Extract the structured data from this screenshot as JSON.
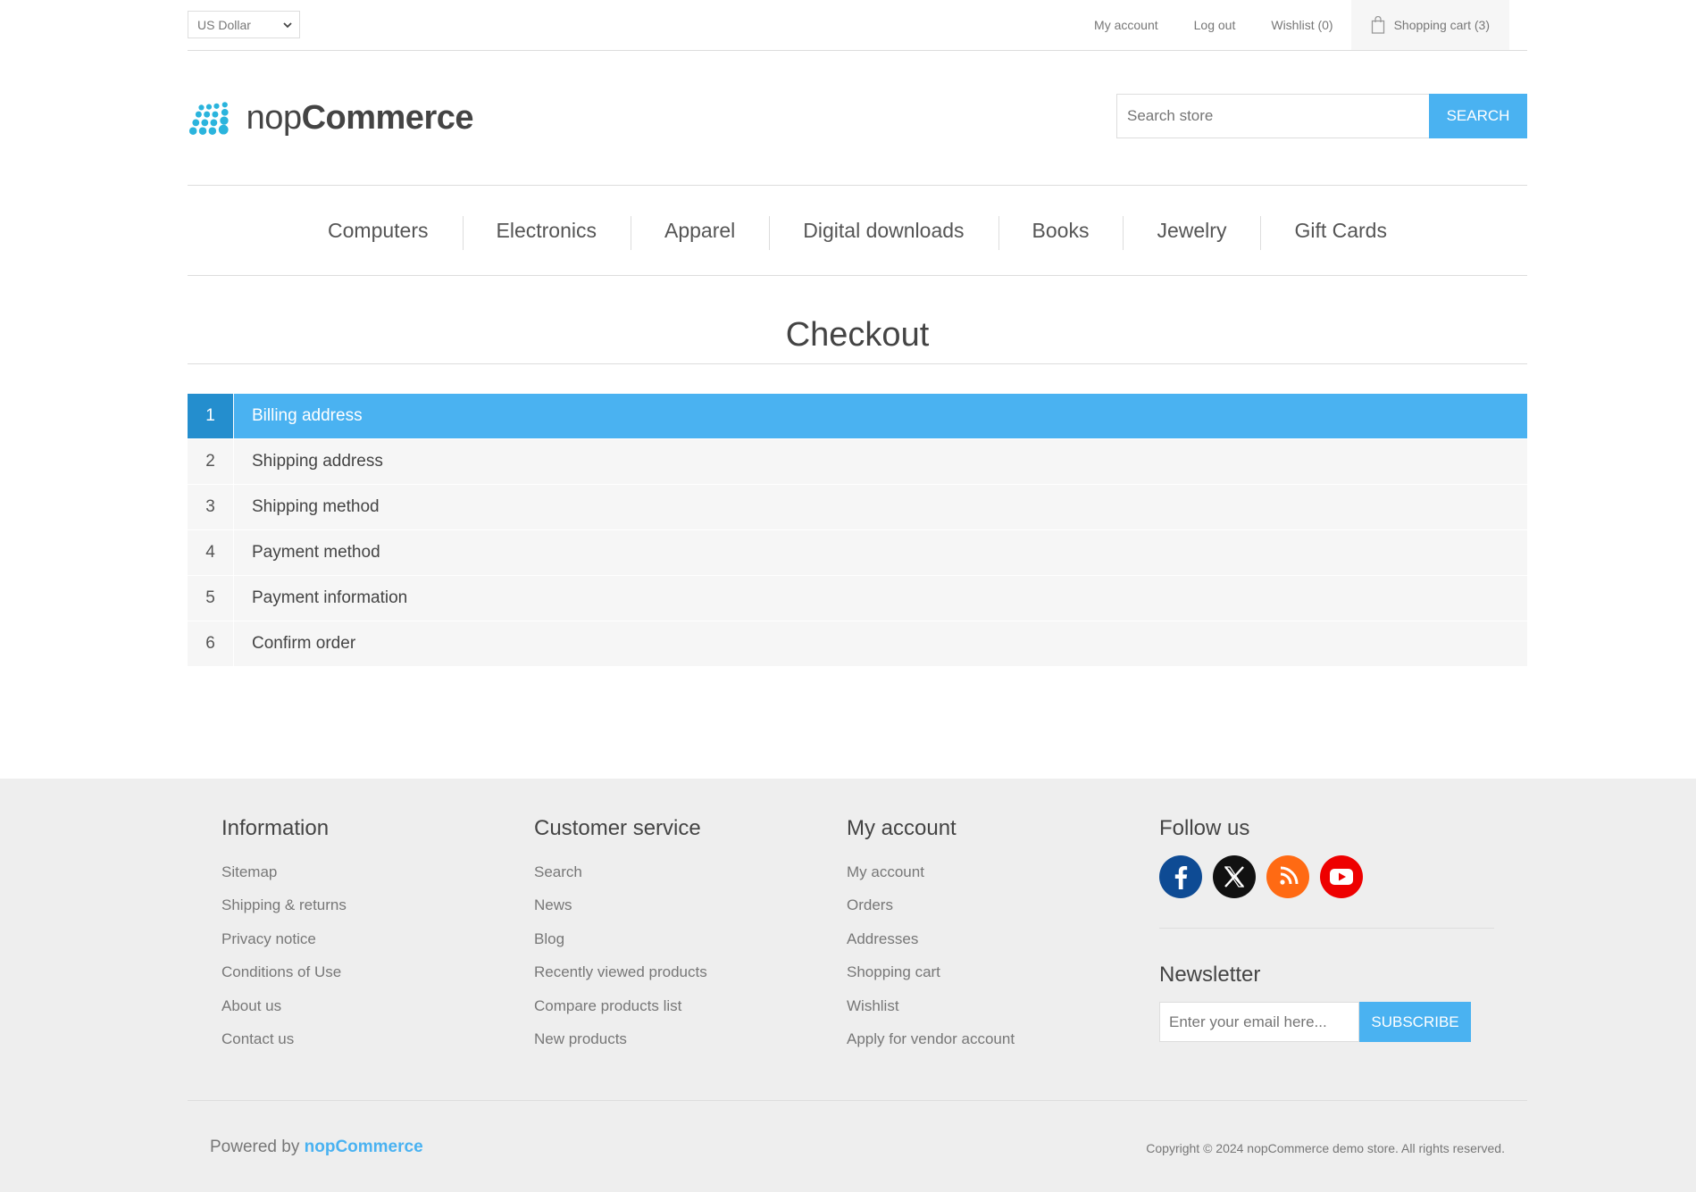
{
  "colors": {
    "accent": "#4ab2f1",
    "accent_dark": "#248ece",
    "footer_bg": "#eeeeee"
  },
  "header": {
    "currency": "US Dollar",
    "links": {
      "my_account": "My account",
      "log_out": "Log out",
      "wishlist": "Wishlist (0)",
      "cart": "Shopping cart (3)"
    }
  },
  "logo": {
    "light": "nop",
    "bold": "Commerce"
  },
  "search": {
    "placeholder": "Search store",
    "button": "SEARCH"
  },
  "menu": [
    "Computers",
    "Electronics",
    "Apparel",
    "Digital downloads",
    "Books",
    "Jewelry",
    "Gift Cards"
  ],
  "page": {
    "title": "Checkout"
  },
  "steps": [
    {
      "num": "1",
      "label": "Billing address",
      "active": true
    },
    {
      "num": "2",
      "label": "Shipping address"
    },
    {
      "num": "3",
      "label": "Shipping method"
    },
    {
      "num": "4",
      "label": "Payment method"
    },
    {
      "num": "5",
      "label": "Payment information"
    },
    {
      "num": "6",
      "label": "Confirm order"
    }
  ],
  "footer": {
    "information": {
      "title": "Information",
      "items": [
        "Sitemap",
        "Shipping & returns",
        "Privacy notice",
        "Conditions of Use",
        "About us",
        "Contact us"
      ]
    },
    "customer_service": {
      "title": "Customer service",
      "items": [
        "Search",
        "News",
        "Blog",
        "Recently viewed products",
        "Compare products list",
        "New products"
      ]
    },
    "my_account": {
      "title": "My account",
      "items": [
        "My account",
        "Orders",
        "Addresses",
        "Shopping cart",
        "Wishlist",
        "Apply for vendor account"
      ]
    },
    "follow_us": {
      "title": "Follow us",
      "icons": [
        "facebook-icon",
        "x-icon",
        "rss-icon",
        "youtube-icon"
      ]
    },
    "newsletter": {
      "title": "Newsletter",
      "placeholder": "Enter your email here...",
      "button": "SUBSCRIBE"
    },
    "powered_prefix": "Powered by",
    "powered_brand": "nopCommerce",
    "copyright": "Copyright © 2024 nopCommerce demo store. All rights reserved."
  }
}
